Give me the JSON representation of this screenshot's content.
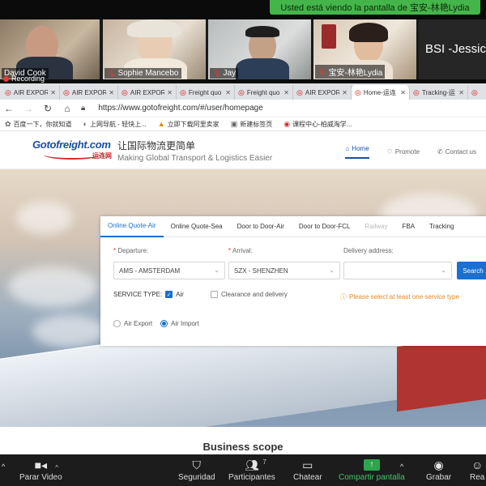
{
  "zoom": {
    "share_banner": "Usted está viendo la pantalla de 宝安-林艳Lydia",
    "recording_label": "Recording",
    "participants": [
      {
        "name": "David Cook",
        "muted": false
      },
      {
        "name": "Sophie Mancebo",
        "muted": true
      },
      {
        "name": "Jay",
        "muted": true
      },
      {
        "name": "宝安-林艳Lydia",
        "muted": true
      },
      {
        "name": "BSI -Jessic",
        "muted": false
      }
    ],
    "toolbar": {
      "video": "Parar Video",
      "security": "Seguridad",
      "participants": "Participantes",
      "participants_count": "7",
      "chat": "Chatear",
      "share": "Compartir pantalla",
      "record": "Grabar",
      "reactions": "Rea"
    }
  },
  "browser": {
    "tabs": [
      {
        "title": "AIR EXPOR",
        "active": false
      },
      {
        "title": "AIR EXPOR",
        "active": false
      },
      {
        "title": "AIR EXPOR",
        "active": false
      },
      {
        "title": "Freight quo",
        "active": false
      },
      {
        "title": "Freight quo",
        "active": false
      },
      {
        "title": "AIR EXPOR",
        "active": false
      },
      {
        "title": "Home-运连",
        "active": true
      },
      {
        "title": "Tracking-运",
        "active": false
      },
      {
        "title": "",
        "active": false
      }
    ],
    "url": "https://www.gotofreight.com/#/user/homepage",
    "bookmarks": [
      "百度一下，你就知道",
      "上网导航 - 轻快上...",
      "立即下载阿里卖家",
      "新建标签页",
      "课程中心-柏威淘学..."
    ]
  },
  "site": {
    "logo_text": "Gotofreight.com",
    "logo_cn": "运连网",
    "slogan_cn": "让国际物流更简单",
    "slogan_en": "Making Global Transport & Logistics Easier",
    "nav": [
      {
        "label": "Home",
        "icon": "home-icon",
        "active": true
      },
      {
        "label": "Promote",
        "icon": "promote-icon",
        "active": false
      },
      {
        "label": "Contact us",
        "icon": "phone-icon",
        "active": false
      }
    ],
    "quote": {
      "tabs": [
        {
          "label": "Online Quote-Air",
          "state": "active"
        },
        {
          "label": "Online Quote-Sea",
          "state": "normal"
        },
        {
          "label": "Door to Door-Air",
          "state": "normal"
        },
        {
          "label": "Door to Door-FCL",
          "state": "normal"
        },
        {
          "label": "Railway",
          "state": "disabled"
        },
        {
          "label": "FBA",
          "state": "normal"
        },
        {
          "label": "Tracking",
          "state": "normal"
        }
      ],
      "departure_label": "Departure:",
      "departure_value": "AMS - AMSTERDAM",
      "arrival_label": "Arrival:",
      "arrival_value": "SZX - SHENZHEN",
      "delivery_label": "Delivery address:",
      "delivery_value": "",
      "search_label": "Search",
      "service_type_label": "SERVICE TYPE:",
      "service_air": "Air",
      "service_clearance": "Clearance and delivery",
      "warning": "Please select at least one service type",
      "radio_export": "Air Export",
      "radio_import": "Air Import"
    },
    "business_scope": "Business scope"
  }
}
